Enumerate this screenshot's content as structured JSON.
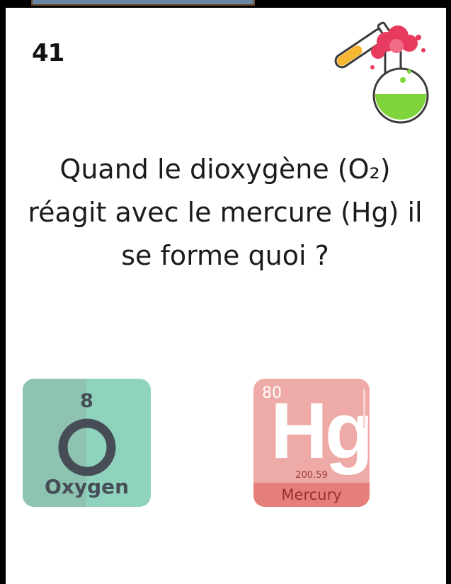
{
  "card": {
    "number": "41",
    "question": "Quand le dioxygène (O₂) réagit avec le mercure (Hg) il se forme quoi ?"
  },
  "elements": {
    "oxygen": {
      "number": "8",
      "symbol": "O",
      "name": "Oxygen"
    },
    "mercury": {
      "number": "80",
      "symbol": "Hg",
      "mass": "200.59",
      "name": "Mercury"
    }
  },
  "icons": [
    "flask-icon",
    "test-tube-icon"
  ]
}
